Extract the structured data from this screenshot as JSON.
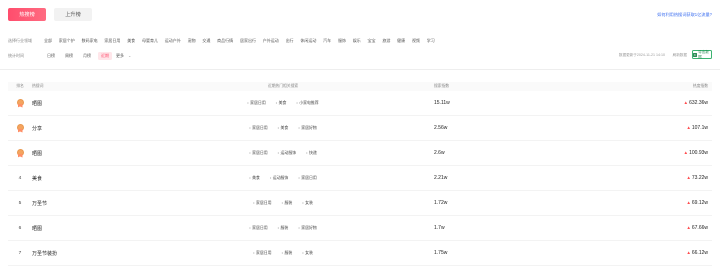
{
  "tabs": {
    "hot": "热搜榜",
    "rise": "上升榜"
  },
  "help_link": "如何利用热搜词获取1亿流量?",
  "categories": {
    "label": "选择行业领域",
    "items": [
      "全部",
      "家居个护",
      "数码家电",
      "家居日用",
      "美食",
      "母婴育儿",
      "运动户外",
      "宠物",
      "交通",
      "商品行情",
      "居家出行",
      "户外运动",
      "出行",
      "休闲运动",
      "汽车",
      "服饰",
      "娱乐",
      "宝宝",
      "旅游",
      "健康",
      "视频",
      "学习"
    ]
  },
  "time": {
    "label": "统计时间",
    "options": [
      "日榜",
      "周榜",
      "月榜",
      "近期"
    ],
    "active_index": 3,
    "more": "更多",
    "more_chevron": "chevron-down-icon"
  },
  "update_time": "数据更新于2024-11-21 14:10",
  "refresh": "刷新数据",
  "export_label": "导出数据",
  "table": {
    "headers": {
      "rank": "排名",
      "word": "热搜词",
      "related": "近期热门相关搜索",
      "search": "搜索指数",
      "heat": "热度指数"
    },
    "rows": [
      {
        "rank": "1",
        "word": "晒图",
        "related": [
          "家居日用",
          "美食",
          "小家电推荐"
        ],
        "search": "15.11w",
        "heat": "632.36w",
        "medal": true
      },
      {
        "rank": "2",
        "word": "分享",
        "related": [
          "家居日用",
          "美食",
          "家居好物"
        ],
        "search": "2.56w",
        "heat": "107.1w",
        "medal": true
      },
      {
        "rank": "3",
        "word": "晒图",
        "related": [
          "家居日用",
          "运动服饰",
          "快递"
        ],
        "search": "2.6w",
        "heat": "100.93w",
        "medal": true
      },
      {
        "rank": "4",
        "word": "美食",
        "related": [
          "美食",
          "运动服饰",
          "家居日用"
        ],
        "search": "2.21w",
        "heat": "73.22w",
        "medal": false
      },
      {
        "rank": "5",
        "word": "万圣节",
        "related": [
          "家居日用",
          "服装",
          "女装"
        ],
        "search": "1.72w",
        "heat": "69.12w",
        "medal": false
      },
      {
        "rank": "6",
        "word": "晒图",
        "related": [
          "家居日用",
          "服装",
          "家居好物"
        ],
        "search": "1.7w",
        "heat": "67.66w",
        "medal": false
      },
      {
        "rank": "7",
        "word": "万圣节装扮",
        "related": [
          "家居日用",
          "服装",
          "女装"
        ],
        "search": "1.75w",
        "heat": "66.12w",
        "medal": false
      }
    ]
  },
  "colors": {
    "accent": "#ff4d6d",
    "link": "#3a6df0",
    "export": "#2e8b57"
  }
}
